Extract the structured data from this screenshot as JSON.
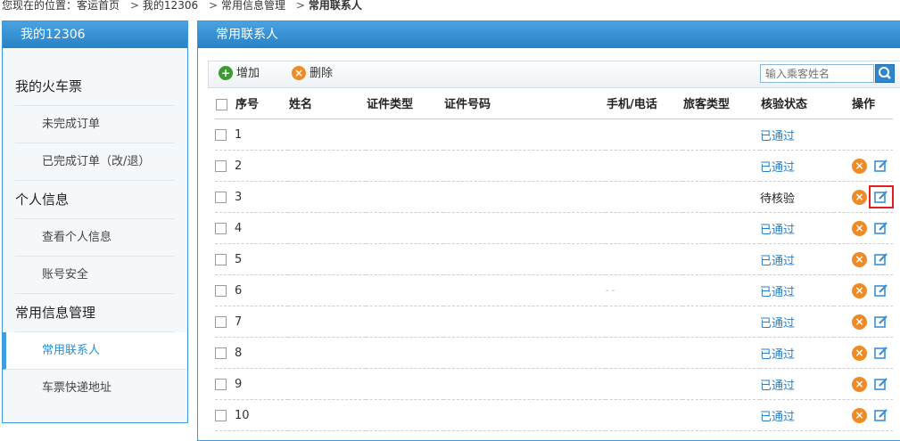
{
  "breadcrumb": {
    "prefix": "您现在的位置：",
    "items": [
      "客运首页",
      "我的12306",
      "常用信息管理"
    ],
    "separator": ">",
    "current": "常用联系人"
  },
  "sidebar": {
    "title": "我的12306",
    "sections": [
      {
        "label": "我的火车票",
        "items": [
          "未完成订单",
          "已完成订单（改/退）"
        ]
      },
      {
        "label": "个人信息",
        "items": [
          "查看个人信息",
          "账号安全"
        ]
      },
      {
        "label": "常用信息管理",
        "items": [
          "常用联系人",
          "车票快递地址"
        ]
      }
    ],
    "active_item": "常用联系人"
  },
  "main": {
    "title": "常用联系人",
    "toolbar": {
      "add_label": "增加",
      "delete_label": "删除",
      "search_placeholder": "输入乘客姓名"
    },
    "columns": [
      "序号",
      "姓名",
      "证件类型",
      "证件号码",
      "手机/电话",
      "旅客类型",
      "核验状态",
      "操作"
    ],
    "rows": [
      {
        "num": "1",
        "phone": "",
        "status": "已通过",
        "status_type": "ok",
        "actions": false
      },
      {
        "num": "2",
        "phone": "",
        "status": "已通过",
        "status_type": "ok",
        "actions": true
      },
      {
        "num": "3",
        "phone": "",
        "status": "待核验",
        "status_type": "pending",
        "actions": true,
        "highlight_edit": true
      },
      {
        "num": "4",
        "phone": "",
        "status": "已通过",
        "status_type": "ok",
        "actions": true
      },
      {
        "num": "5",
        "phone": "",
        "status": "已通过",
        "status_type": "ok",
        "actions": true
      },
      {
        "num": "6",
        "phone": "- -",
        "status": "已通过",
        "status_type": "ok",
        "actions": true
      },
      {
        "num": "7",
        "phone": "",
        "status": "已通过",
        "status_type": "ok",
        "actions": true
      },
      {
        "num": "8",
        "phone": "",
        "status": "已通过",
        "status_type": "ok",
        "actions": true
      },
      {
        "num": "9",
        "phone": "",
        "status": "已通过",
        "status_type": "ok",
        "actions": true
      },
      {
        "num": "10",
        "phone": "",
        "status": "已通过",
        "status_type": "ok",
        "actions": true
      }
    ]
  },
  "colors": {
    "accent": "#2b7ec6",
    "header_blue": "#3a93d6",
    "delete_orange": "#f08a24",
    "add_green": "#3a9b2f",
    "highlight_red": "#e02020"
  },
  "icons": {
    "add": "plus-circle-icon",
    "delete": "x-circle-icon",
    "edit": "edit-pencil-icon",
    "search": "search-icon"
  }
}
